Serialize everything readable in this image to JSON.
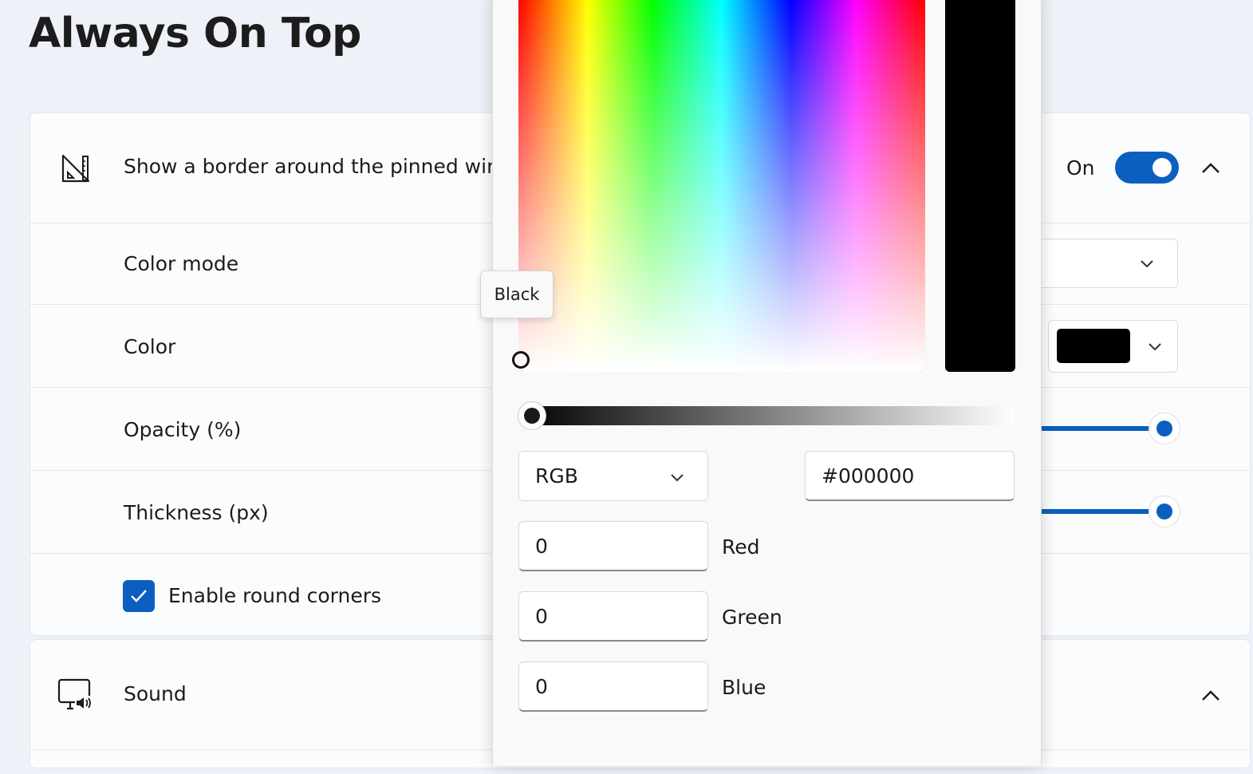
{
  "page": {
    "title": "Always On Top"
  },
  "border_card": {
    "header_label": "Show a border around the pinned window",
    "toggle_text": "On",
    "toggle_on": true,
    "rows": {
      "color_mode": "Color mode",
      "color": "Color",
      "color_swatch": "#000000",
      "opacity": "Opacity (%)",
      "thickness": "Thickness (px)",
      "round_corners": "Enable round corners"
    },
    "round_corners_checked": true
  },
  "sound_card": {
    "header_label": "Sound"
  },
  "color_picker": {
    "tooltip": "Black",
    "selected_color": "#000000",
    "mode": "RGB",
    "hex": "#000000",
    "channels": [
      {
        "value": "0",
        "label": "Red"
      },
      {
        "value": "0",
        "label": "Green"
      },
      {
        "value": "0",
        "label": "Blue"
      }
    ]
  },
  "icons": {
    "border_icon": "ruler-triangle-icon",
    "sound_icon": "monitor-speaker-icon",
    "collapse": "chevron-up-icon",
    "dropdown": "chevron-down-icon",
    "check": "checkmark-icon"
  },
  "colors": {
    "accent": "#0A5FBF",
    "background": "#EEF2F8",
    "card": "#FBFCFD"
  }
}
